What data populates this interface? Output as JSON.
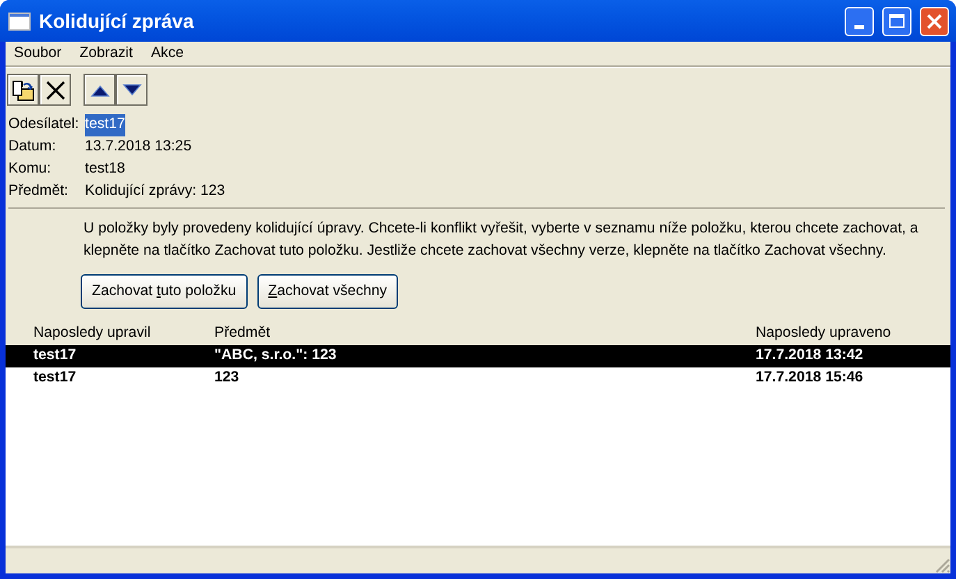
{
  "window": {
    "title": "Kolidující zpráva"
  },
  "menu": [
    "Soubor",
    "Zobrazit",
    "Akce"
  ],
  "toolbar": [
    {
      "kind": "open"
    },
    {
      "kind": "delete"
    },
    {
      "kind": "separator"
    },
    {
      "kind": "up"
    },
    {
      "kind": "down"
    }
  ],
  "fields": [
    {
      "label": "Odesílatel:",
      "value": "test17",
      "highlighted": true
    },
    {
      "label": "Datum:",
      "value": "13.7.2018 13:25",
      "highlighted": false
    },
    {
      "label": "Komu:",
      "value": "test18",
      "highlighted": false
    },
    {
      "label": "Předmět:",
      "value": "Kolidující zprávy: 123",
      "highlighted": false
    }
  ],
  "message": "U položky byly provedeny kolidující úpravy. Chcete-li konflikt vyřešit, vyberte v seznamu níže položku, kterou chcete zachovat, a klepněte na tlačítko Zachovat tuto položku. Jestliže chcete zachovat všechny verze, klepněte na tlačítko Zachovat všechny.",
  "buttons": [
    {
      "before": "Zachovat ",
      "accelerator": "t",
      "after": "uto položku"
    },
    {
      "accelerator": "Z",
      "after": "achovat všechny"
    }
  ],
  "table": {
    "columns": [
      "Naposledy upravil",
      "Předmět",
      "Naposledy upraveno"
    ],
    "rows": [
      {
        "cells": [
          "test17",
          "\"ABC, s.r.o.\": 123",
          "17.7.2018 13:42"
        ],
        "selected": true
      },
      {
        "cells": [
          "test17",
          "123",
          "17.7.2018 15:46"
        ],
        "selected": false
      }
    ]
  }
}
